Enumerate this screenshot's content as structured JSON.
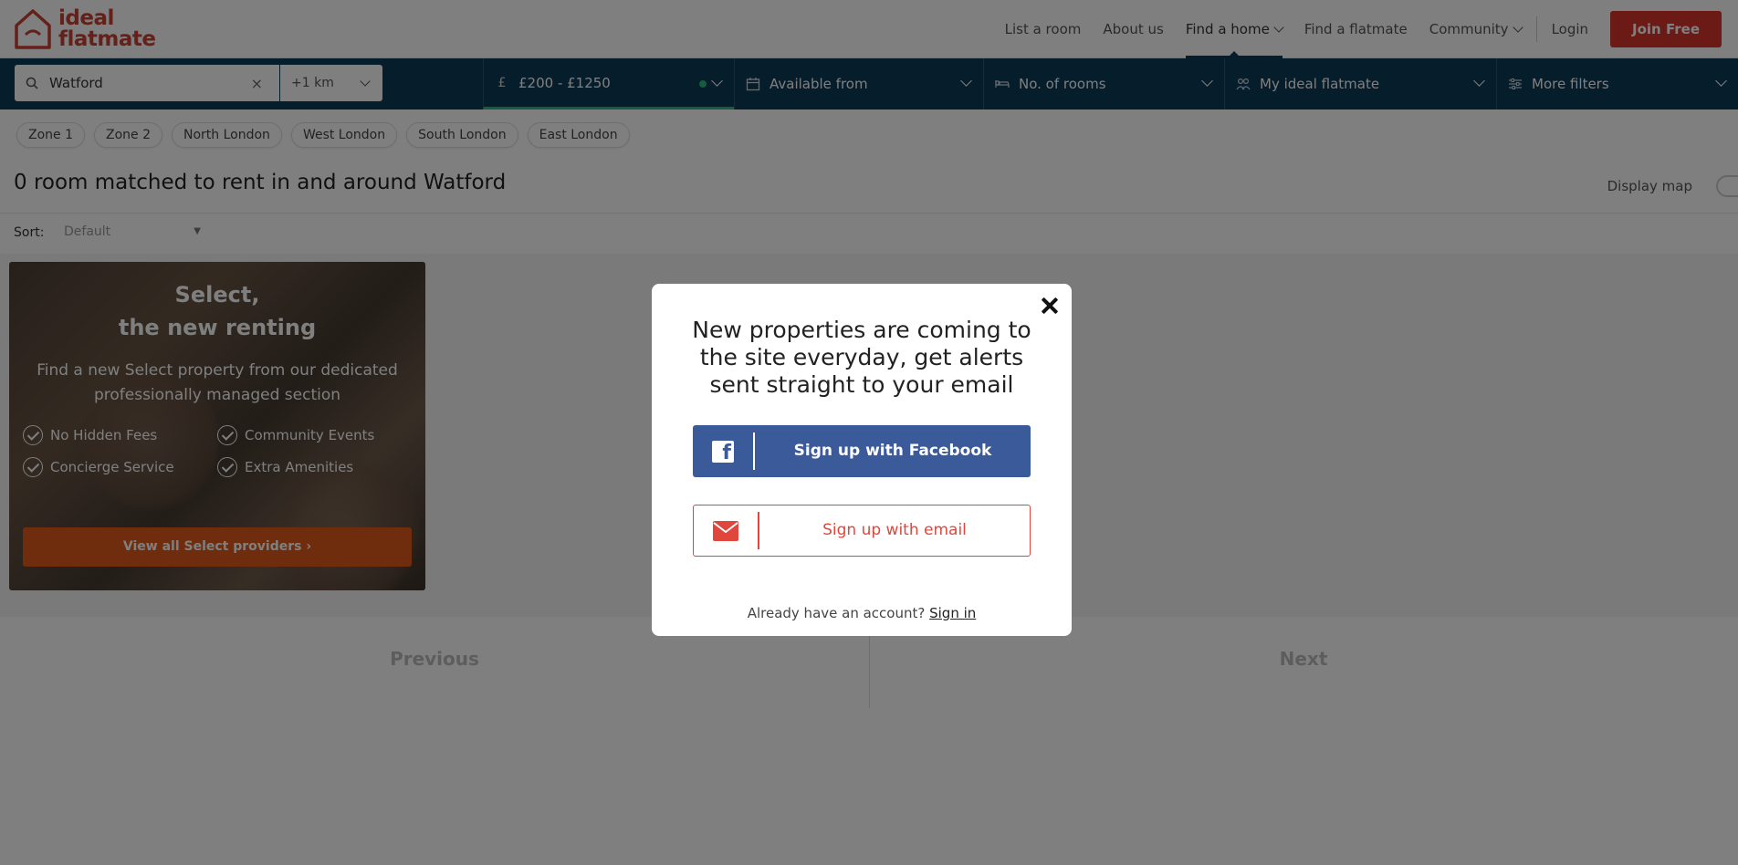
{
  "brand": {
    "line1": "ideal",
    "line2": "flatmate",
    "accent": "#c94335"
  },
  "nav": {
    "items": [
      {
        "label": "List a room"
      },
      {
        "label": "About us"
      },
      {
        "label": "Find a home"
      },
      {
        "label": "Find a flatmate"
      },
      {
        "label": "Community"
      }
    ],
    "login": "Login",
    "join": "Join Free"
  },
  "filters": {
    "location_value": "Watford",
    "clear": "×",
    "radius": "+1 km",
    "price": "£200 - £1250",
    "price_icon": "£",
    "available": "Available from",
    "rooms": "No. of rooms",
    "flatmate": "My ideal flatmate",
    "more": "More filters"
  },
  "zones": [
    "Zone 1",
    "Zone 2",
    "North London",
    "West London",
    "South London",
    "East London"
  ],
  "results": {
    "title": "0 room matched to rent in and around Watford",
    "display_map": "Display map",
    "sort_label": "Sort:",
    "sort_value": "Default"
  },
  "promo": {
    "title_line1": "Select,",
    "title_line2": "the new renting",
    "description": "Find a new Select property from our dedicated professionally managed section",
    "features": [
      "No Hidden Fees",
      "Community Events",
      "Concierge Service",
      "Extra Amenities"
    ],
    "button": "View all Select providers ›"
  },
  "pager": {
    "previous": "Previous",
    "next": "Next"
  },
  "modal": {
    "heading": "New properties are coming to the site everyday, get alerts sent straight to your email",
    "facebook": "Sign up with Facebook",
    "email": "Sign up with email",
    "already": "Already have an account?",
    "signin": "Sign in"
  },
  "colors": {
    "navy": "#0d3a58",
    "facebook": "#3b5a99",
    "red": "#d9342b",
    "orange": "#e05b1c",
    "green": "#2db87d"
  }
}
